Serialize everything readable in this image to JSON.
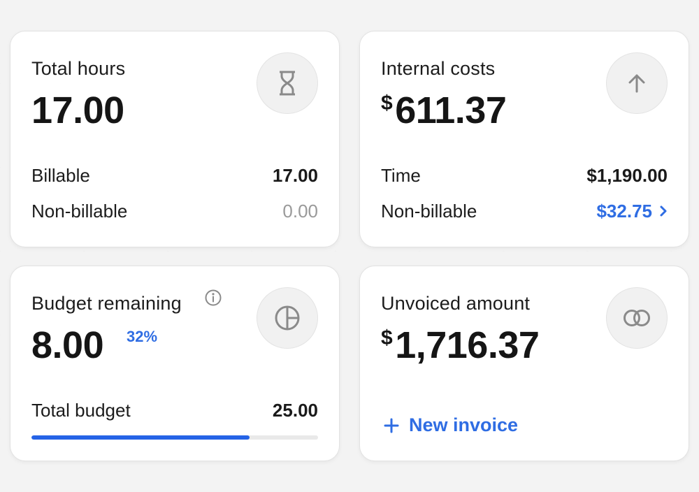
{
  "total_hours": {
    "title": "Total hours",
    "value": "17.00",
    "rows": [
      {
        "label": "Billable",
        "value": "17.00"
      },
      {
        "label": "Non-billable",
        "value": "0.00"
      }
    ],
    "icon": "hourglass-icon"
  },
  "internal_costs": {
    "title": "Internal costs",
    "currency": "$",
    "value": "611.37",
    "rows": [
      {
        "label": "Time",
        "value": "$1,190.00"
      },
      {
        "label": "Non-billable",
        "value": "$32.75"
      }
    ],
    "icon": "arrow-up-icon"
  },
  "budget_remaining": {
    "title": "Budget remaining",
    "value": "8.00",
    "percent": "32%",
    "progress_fraction": 0.76,
    "total_label": "Total budget",
    "total_value": "25.00",
    "icon": "pie-chart-icon"
  },
  "unvoiced_amount": {
    "title": "Unvoiced amount",
    "currency": "$",
    "value": "1,716.37",
    "action_label": "New invoice",
    "icon": "rings-icon"
  },
  "colors": {
    "accent": "#2f6de3",
    "progress": "#2563e6",
    "muted": "#9a9a9a"
  }
}
